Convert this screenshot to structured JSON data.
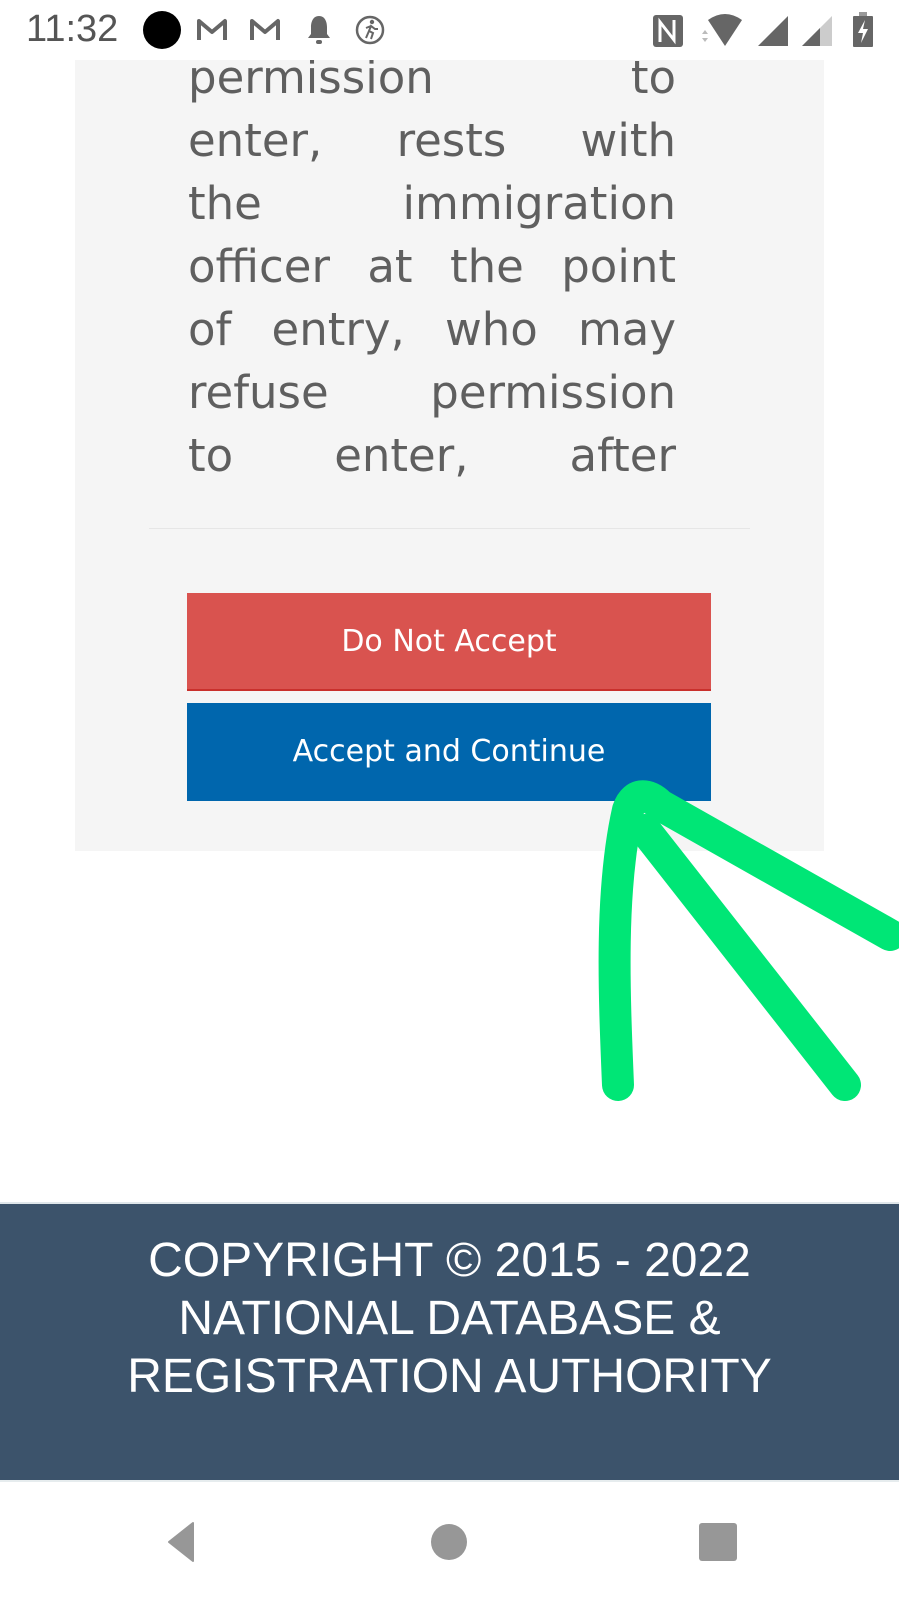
{
  "status_bar": {
    "time": "11:32",
    "left_icons": [
      "record-dot-icon",
      "gmail-icon",
      "gmail-icon",
      "notification-bell-icon",
      "activity-tracker-icon"
    ],
    "right_icons": [
      "nfc-icon",
      "wifi-icon",
      "signal-full-icon",
      "signal-partial-icon",
      "battery-charging-icon"
    ]
  },
  "terms": {
    "lines": [
      [
        "permission",
        "to"
      ],
      [
        "enter,",
        "rests",
        "with"
      ],
      [
        "the",
        "immigration"
      ],
      [
        "officer",
        "at",
        "the",
        "point"
      ],
      [
        "of",
        "entry,",
        "who",
        "may"
      ],
      [
        "refuse",
        "permission"
      ],
      [
        "to",
        "enter,",
        "after"
      ]
    ]
  },
  "actions": {
    "decline_label": "Do Not Accept",
    "accept_label": "Accept and Continue"
  },
  "colors": {
    "decline": "#d9534f",
    "accept": "#0066ad",
    "footer": "#3c536b",
    "annotation": "#00e676"
  },
  "footer": {
    "line1": "COPYRIGHT © 2015 - 2022",
    "line2": "NATIONAL DATABASE &",
    "line3": "REGISTRATION AUTHORITY"
  },
  "nav_bar": {
    "buttons": [
      "back",
      "home",
      "recents"
    ]
  }
}
